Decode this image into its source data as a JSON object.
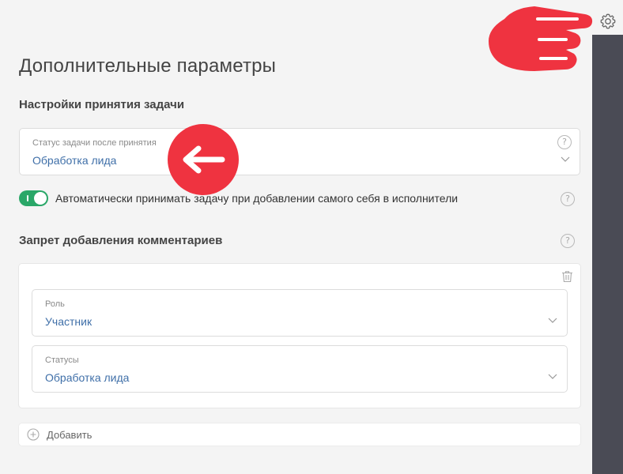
{
  "page_title": "Дополнительные параметры",
  "acceptance": {
    "section_title": "Настройки принятия задачи",
    "status_field": {
      "label": "Статус задачи после принятия",
      "value": "Обработка лида"
    },
    "auto_accept": {
      "label": "Автоматически принимать задачу при добавлении самого себя в исполнители",
      "enabled": true
    }
  },
  "comments_ban": {
    "section_title": "Запрет добавления комментариев",
    "role_field": {
      "label": "Роль",
      "value": "Участник"
    },
    "statuses_field": {
      "label": "Статусы",
      "value": "Обработка лида"
    },
    "add_label": "Добавить"
  },
  "help_symbol": "?",
  "colors": {
    "accent_text": "#3f6fa8",
    "toggle_on": "#2aa768",
    "side_panel": "#4a4b55",
    "annotation_red": "#ef3340"
  },
  "icons": {
    "settings": "gear-icon",
    "help": "help-icon",
    "dropdown": "chevron-down-icon",
    "delete": "trash-icon",
    "add": "plus-circle-icon",
    "annotation_pointer": "pointing-hand-icon",
    "annotation_arrow": "arrow-left-icon"
  }
}
